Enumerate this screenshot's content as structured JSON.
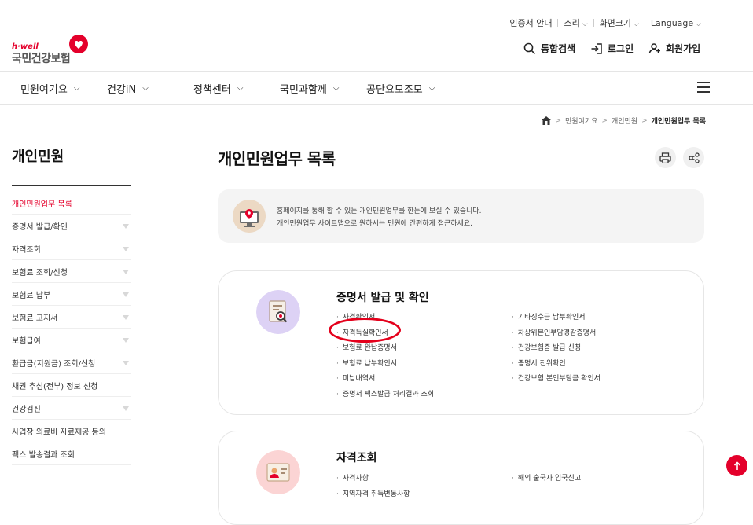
{
  "util_nav": {
    "cert_guide": "인증서 안내",
    "sound": "소리",
    "font_size": "화면크기",
    "language": "Language"
  },
  "logo": {
    "sub": "h·well",
    "main": "국민건강보험"
  },
  "header_actions": {
    "search": "통합검색",
    "login": "로그인",
    "signup": "회원가입"
  },
  "gnb": [
    "민원여기요",
    "건강iN",
    "정책센터",
    "국민과함께",
    "공단요모조모"
  ],
  "breadcrumb": [
    "민원여기요",
    "개인민원",
    "개인민원업무 목록"
  ],
  "sidebar": {
    "title": "개인민원",
    "items": [
      {
        "label": "개인민원업무 목록",
        "active": true,
        "expandable": false
      },
      {
        "label": "증명서 발급/확인",
        "active": false,
        "expandable": true
      },
      {
        "label": "자격조회",
        "active": false,
        "expandable": true
      },
      {
        "label": "보험료 조회/신청",
        "active": false,
        "expandable": true
      },
      {
        "label": "보험료 납부",
        "active": false,
        "expandable": true
      },
      {
        "label": "보험료 고지서",
        "active": false,
        "expandable": true
      },
      {
        "label": "보험급여",
        "active": false,
        "expandable": true
      },
      {
        "label": "환급금(지원금) 조회/신청",
        "active": false,
        "expandable": true
      },
      {
        "label": "채권 추심(전부) 정보 신청",
        "active": false,
        "expandable": false
      },
      {
        "label": "건강검진",
        "active": false,
        "expandable": true
      },
      {
        "label": "사업장 의료비 자료제공 동의",
        "active": false,
        "expandable": false
      },
      {
        "label": "팩스 발송결과 조회",
        "active": false,
        "expandable": false
      }
    ]
  },
  "main": {
    "title": "개인민원업무 목록",
    "info_line1": "홈페이지를 통해 할 수 있는 개인민원업무를 한눈에 보실 수 있습니다.",
    "info_line2": "개인민원업무 사이트맵으로 원하시는 민원에 간편하게 접근하세요."
  },
  "cards": [
    {
      "title": "증명서 발급 및 확인",
      "left": [
        "자격확인서",
        "자격득실확인서",
        "보험료 완납증명서",
        "보험료 납부확인서",
        "미납내역서",
        "증명서 팩스발급 처리결과 조회"
      ],
      "right": [
        "기타징수금 납부확인서",
        "차상위본인부담경감증명서",
        "건강보험증 발급 신청",
        "증명서 진위확인",
        "건강보험 본인부담금 확인서"
      ]
    },
    {
      "title": "자격조회",
      "left": [
        "자격사항",
        "지역자격 취득변동사항"
      ],
      "right": [
        "해외 출국자 입국신고"
      ]
    }
  ],
  "colors": {
    "brand_red": "#e4002b",
    "card1_icon_bg": "#ddd2f5",
    "card2_icon_bg": "#fbd4d4"
  }
}
